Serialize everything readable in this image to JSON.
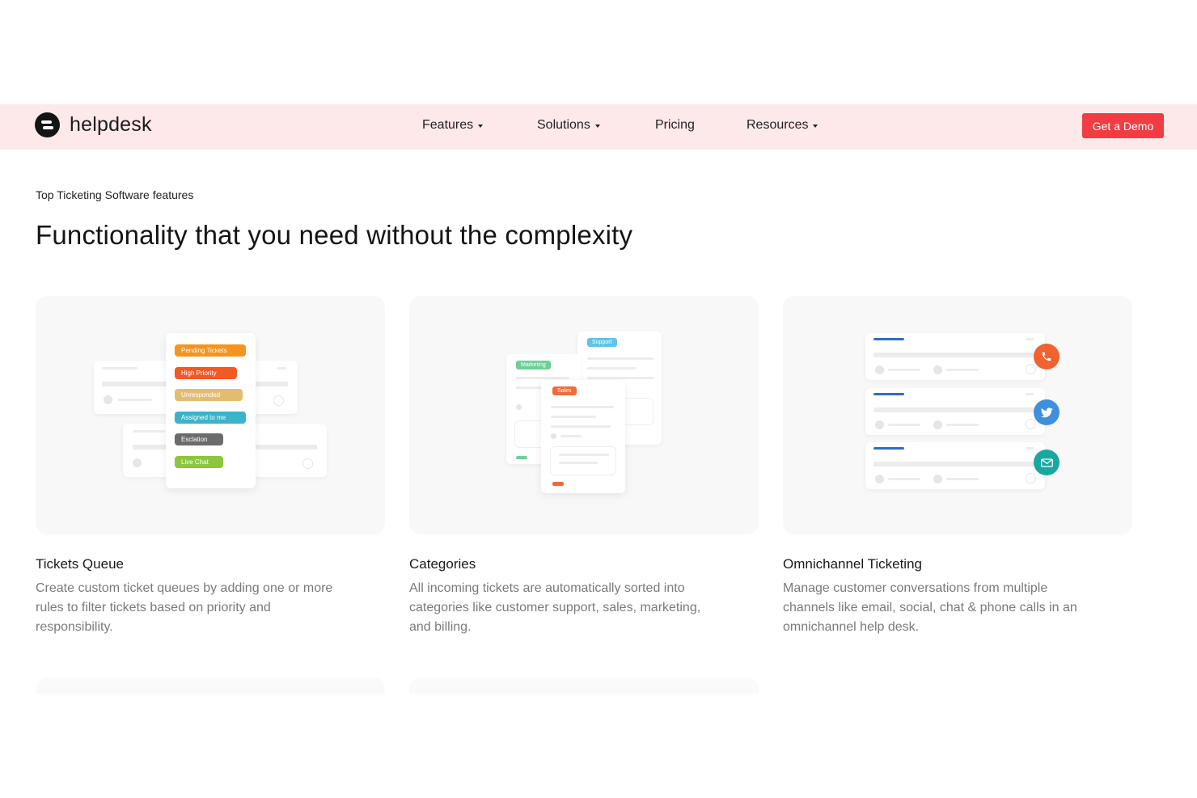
{
  "nav": {
    "logo_text": "helpdesk",
    "items": [
      {
        "label": "Features",
        "has_caret": true
      },
      {
        "label": "Solutions",
        "has_caret": true
      },
      {
        "label": "Pricing",
        "has_caret": false
      },
      {
        "label": "Resources",
        "has_caret": true
      }
    ],
    "cta_label": "Get a Demo"
  },
  "section": {
    "eyebrow": "Top Ticketing Software features",
    "title": "Functionality that you need without the complexity"
  },
  "cards": [
    {
      "title": "Tickets Queue",
      "description": "Create custom ticket queues by adding one or more rules to filter tickets based on priority and responsibility.",
      "pills": [
        {
          "label": "Pending Tickets",
          "color": "#f7941d"
        },
        {
          "label": "High Priority",
          "color": "#f15a24"
        },
        {
          "label": "Unresponded",
          "color": "#e3bd6f"
        },
        {
          "label": "Assigned to me",
          "color": "#3bb3c9"
        },
        {
          "label": "Esclation",
          "color": "#6b6b6b"
        },
        {
          "label": "Live Chat",
          "color": "#8cc63f"
        }
      ]
    },
    {
      "title": "Categories",
      "description": "All incoming tickets are automatically sorted into categories like customer support, sales, marketing, and billing.",
      "tags": [
        {
          "label": "Support",
          "color": "#5ec4ea"
        },
        {
          "label": "Marketing",
          "color": "#6fcf97"
        },
        {
          "label": "Sales",
          "color": "#f26b3a"
        }
      ]
    },
    {
      "title": "Omnichannel Ticketing",
      "description": "Manage customer conversations from multiple channels like email, social, chat & phone calls in an omnichannel help desk.",
      "channels": [
        {
          "icon": "phone-icon",
          "color": "#f26130"
        },
        {
          "icon": "twitter-icon",
          "color": "#3f8fe0"
        },
        {
          "icon": "mail-icon",
          "color": "#18a8a0"
        }
      ]
    }
  ],
  "colors": {
    "nav_bg": "#fde8ea",
    "cta_bg": "#f23c43",
    "card_bg": "#f8f8f8"
  }
}
